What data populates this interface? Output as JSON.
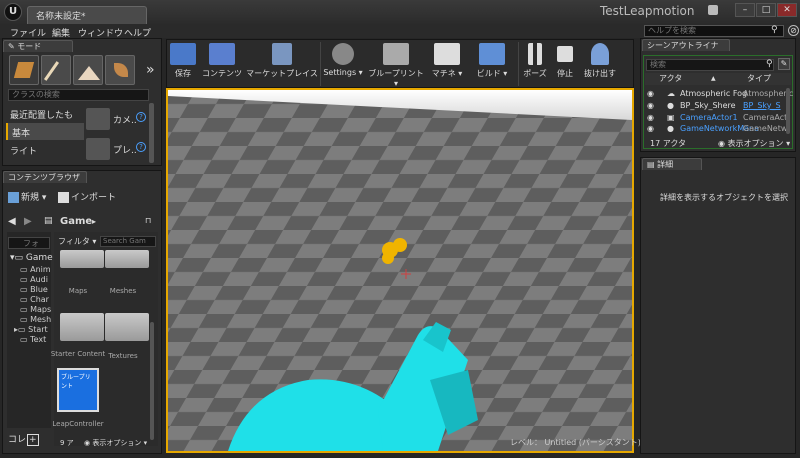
{
  "window": {
    "tab_title": "名称未設定*",
    "project_name": "TestLeapmotion",
    "minimize": "–",
    "maximize": "□",
    "close": "✕",
    "logo": "U"
  },
  "menu": {
    "items": [
      "ファイル",
      "編集",
      "ウィンドウ",
      "ヘルプ"
    ],
    "help_search_placeholder": "ヘルプを検索"
  },
  "modes": {
    "tab": "モード",
    "search_placeholder": "クラスの検索",
    "categories": [
      "最近配置したもの",
      "基本",
      "ライト"
    ],
    "items": [
      {
        "label": "カメ..",
        "icon": "camera-icon"
      },
      {
        "label": "プレ..",
        "icon": "player-start-icon"
      }
    ],
    "more": "»"
  },
  "toolbar": {
    "buttons": [
      {
        "label": "保存",
        "icon": "save-icon"
      },
      {
        "label": "コンテンツ",
        "icon": "content-icon"
      },
      {
        "label": "マーケットプレイス",
        "icon": "marketplace-icon"
      },
      {
        "label": "Settings",
        "icon": "settings-icon"
      },
      {
        "label": "ブループリント",
        "icon": "blueprint-icon"
      },
      {
        "label": "マチネ",
        "icon": "matinee-icon"
      },
      {
        "label": "ビルド",
        "icon": "build-icon"
      },
      {
        "label": "ポーズ",
        "icon": "pause-icon"
      },
      {
        "label": "停止",
        "icon": "stop-icon"
      },
      {
        "label": "抜け出す",
        "icon": "eject-icon"
      }
    ]
  },
  "viewport": {
    "level_label": "レベル：",
    "level_value": "Untitled (パーシスタント)"
  },
  "outliner": {
    "tab": "シーンアウトライナ",
    "search_placeholder": "検索",
    "col_actor": "アクタ",
    "col_type": "タイプ",
    "rows": [
      {
        "name": "Atmospheric Fog",
        "type": "Atmospheric",
        "link": false
      },
      {
        "name": "BP_Sky_Shere",
        "type": "BP_Sky_S",
        "link": true
      },
      {
        "name": "CameraActor1",
        "type": "CameraAct",
        "link": false
      },
      {
        "name": "GameNetworkMana",
        "type": "GameNetw",
        "link": false
      }
    ],
    "count": "17 アクタ",
    "view_options": "表示オプション"
  },
  "details": {
    "tab": "詳細",
    "empty_message": "詳細を表示するオブジェクトを選択"
  },
  "content_browser": {
    "tab": "コンテンツブラウザ",
    "new_label": "新規",
    "import_label": "インポート",
    "path": "Game",
    "folder_filter_placeholder": "フォ",
    "tree": [
      "Game",
      "Anim",
      "Audi",
      "Blue",
      "Char",
      "Maps",
      "Mesh",
      "Start",
      "Text"
    ],
    "filter_label": "フィルタ",
    "search_placeholder": "Search Gam",
    "assets": [
      {
        "label": "Maps"
      },
      {
        "label": "Meshes"
      },
      {
        "label": "Starter Content"
      },
      {
        "label": "Textures"
      },
      {
        "label": "LeapController",
        "thumb": "ブループリント"
      }
    ],
    "collections_label": "コレ",
    "item_count": "9 ア",
    "view_options": "表示オプション"
  },
  "colors": {
    "accent": "#e6a800",
    "link": "#4aa0ff",
    "hand": "#1fe0e8",
    "blueprint_thumb": "#1a6fe0",
    "outliner_highlight": "#2a6e2a"
  }
}
